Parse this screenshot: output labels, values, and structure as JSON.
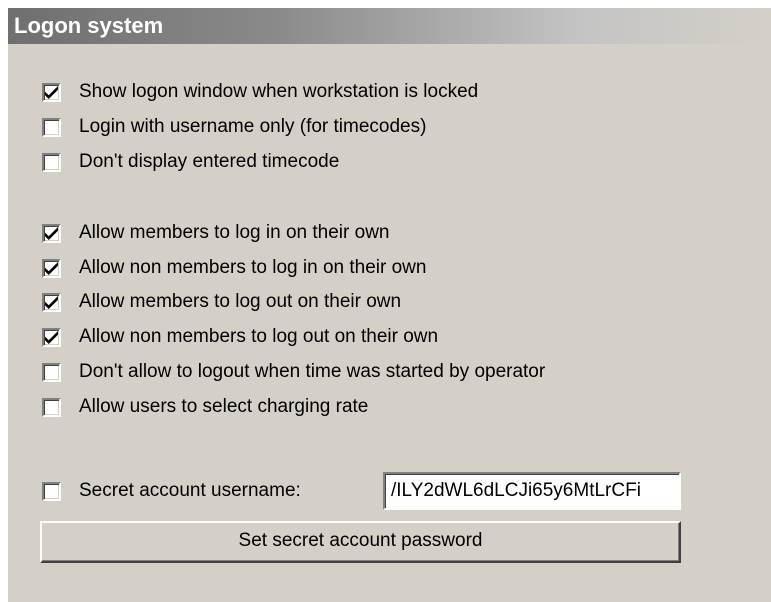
{
  "header": {
    "title": "Logon system"
  },
  "options": [
    {
      "label": "Show logon window when workstation is locked",
      "checked": true
    },
    {
      "label": "Login with username only (for timecodes)",
      "checked": false
    },
    {
      "label": "Don't display entered timecode",
      "checked": false
    },
    {
      "label": "Allow members to log in on their own",
      "checked": true
    },
    {
      "label": "Allow non members to log in on their own",
      "checked": true
    },
    {
      "label": "Allow members to log out on their own",
      "checked": true
    },
    {
      "label": "Allow non members to log out on their own",
      "checked": true
    },
    {
      "label": "Don't allow to logout when time was started by operator",
      "checked": false
    },
    {
      "label": "Allow users to select charging rate",
      "checked": false
    }
  ],
  "secret": {
    "label": "Secret account username:",
    "checked": false,
    "value": "/ILY2dWL6dLCJi65y6MtLrCFi",
    "button_label": "Set secret account password"
  }
}
